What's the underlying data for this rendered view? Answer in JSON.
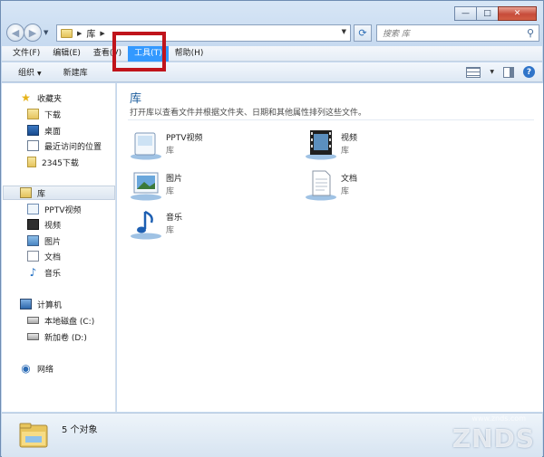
{
  "window": {
    "caption": {
      "minimize": "—",
      "maximize": "□",
      "close": "✕"
    }
  },
  "nav": {
    "back_glyph": "◀",
    "forward_glyph": "▶",
    "breadcrumb": [
      "库"
    ],
    "refresh_glyph": "⟳",
    "search_placeholder": "搜索 库",
    "search_glyph": "⚲"
  },
  "menu": {
    "items": [
      "文件(F)",
      "编辑(E)",
      "查看(V)",
      "工具(T)",
      "帮助(H)"
    ]
  },
  "commands": {
    "organize": "组织",
    "new_library": "新建库",
    "help_glyph": "?"
  },
  "sidebar": {
    "favorites_label": "收藏夹",
    "favorites": [
      "下载",
      "桌面",
      "最近访问的位置",
      "2345下载"
    ],
    "libraries_label": "库",
    "libraries": [
      "PPTV视频",
      "视频",
      "图片",
      "文档",
      "音乐"
    ],
    "computer_label": "计算机",
    "drives": [
      "本地磁盘 (C:)",
      "新加卷 (D:)"
    ],
    "network_label": "网络"
  },
  "main": {
    "title": "库",
    "description": "打开库以查看文件并根据文件夹、日期和其他属性排列这些文件。",
    "tiles": [
      {
        "name": "PPTV视频",
        "sub": "库"
      },
      {
        "name": "视频",
        "sub": "库"
      },
      {
        "name": "图片",
        "sub": "库"
      },
      {
        "name": "文档",
        "sub": "库"
      },
      {
        "name": "音乐",
        "sub": "库"
      }
    ]
  },
  "status": {
    "text": "5 个对象"
  },
  "watermark": {
    "main": "ZNDS",
    "sub": "www.znds.com"
  }
}
